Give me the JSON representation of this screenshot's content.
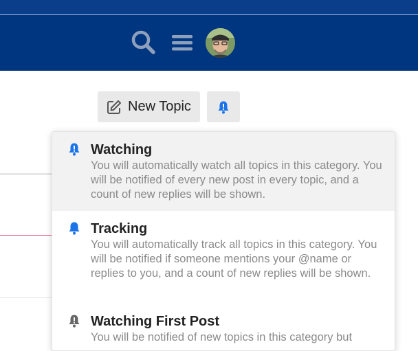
{
  "header": {
    "search_icon": "search-icon",
    "menu_icon": "hamburger-menu-icon",
    "avatar": "user-avatar"
  },
  "toolbar": {
    "new_topic_label": "New Topic",
    "notification_icon": "bell-icon"
  },
  "notification_menu": {
    "options": [
      {
        "title": "Watching",
        "description": "You will automatically watch all topics in this category. You will be notified of every new post in every topic, and a count of new replies will be shown.",
        "icon": "bell-exclamation-icon",
        "icon_color": "#1a73e8",
        "highlighted": true
      },
      {
        "title": "Tracking",
        "description": "You will automatically track all topics in this category. You will be notified if someone mentions your @name or replies to you, and a count of new replies will be shown.",
        "icon": "bell-icon",
        "icon_color": "#1a73e8"
      },
      {
        "title": "Watching First Post",
        "description": "You will be notified of new topics in this category but",
        "icon": "bell-exclamation-icon",
        "icon_color": "#666666"
      }
    ]
  },
  "colors": {
    "header_bg": "#003580",
    "accent": "#1a73e8"
  }
}
